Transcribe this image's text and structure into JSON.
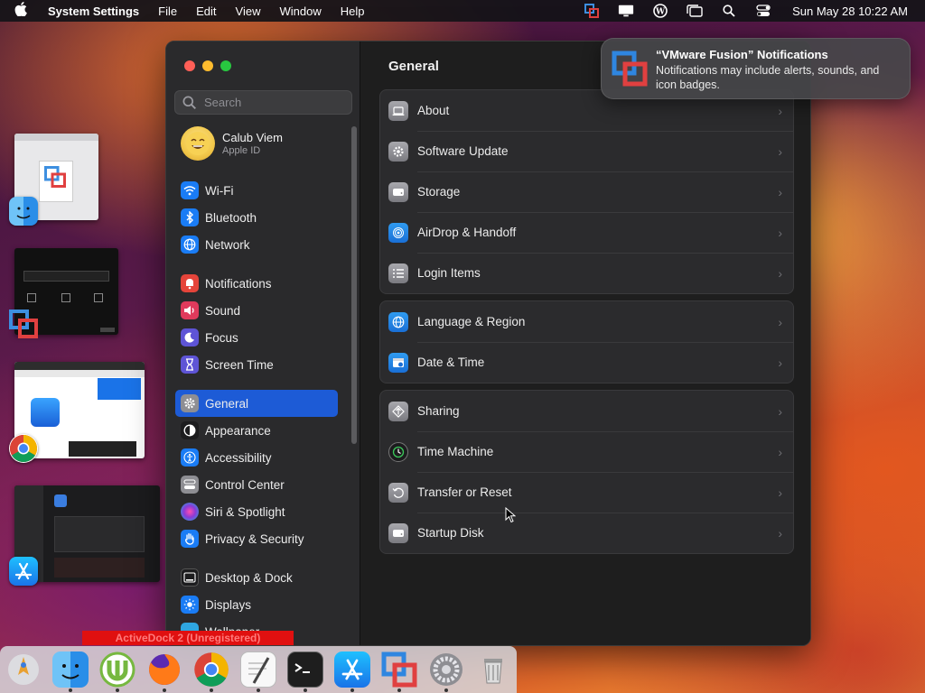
{
  "menubar": {
    "apple_icon": "apple-logo-icon",
    "app_name": "System Settings",
    "menus": [
      "File",
      "Edit",
      "View",
      "Window",
      "Help"
    ],
    "clock": "Sun May 28  10:22 AM",
    "status_icons": [
      "vmware-fusion-icon",
      "display-icon",
      "wordpress-icon",
      "stage-manager-icon",
      "search-icon",
      "control-center-icon"
    ]
  },
  "window": {
    "search_placeholder": "Search",
    "profile": {
      "name": "Calub Viem",
      "subtitle": "Apple ID"
    },
    "sidebar": {
      "items": [
        {
          "label": "Wi-Fi",
          "icon": "wifi-icon",
          "color": "#1a7cf5"
        },
        {
          "label": "Bluetooth",
          "icon": "bluetooth-icon",
          "color": "#1a7cf5"
        },
        {
          "label": "Network",
          "icon": "globe-icon",
          "color": "#1a7cf5"
        },
        {
          "label": "Notifications",
          "icon": "bell-icon",
          "color": "#e5443a"
        },
        {
          "label": "Sound",
          "icon": "speaker-icon",
          "color": "#e03a5c"
        },
        {
          "label": "Focus",
          "icon": "moon-icon",
          "color": "#5e54d6"
        },
        {
          "label": "Screen Time",
          "icon": "hourglass-icon",
          "color": "#5e54d6"
        },
        {
          "label": "General",
          "icon": "gear-icon",
          "color": "#8e8e93",
          "active": true
        },
        {
          "label": "Appearance",
          "icon": "appearance-icon",
          "color": "#1c1c1e"
        },
        {
          "label": "Accessibility",
          "icon": "accessibility-icon",
          "color": "#1a7cf5"
        },
        {
          "label": "Control Center",
          "icon": "control-center-icon",
          "color": "#8e8e93"
        },
        {
          "label": "Siri & Spotlight",
          "icon": "siri-icon",
          "color": "#b03ab5"
        },
        {
          "label": "Privacy & Security",
          "icon": "hand-icon",
          "color": "#1a7cf5"
        },
        {
          "label": "Desktop & Dock",
          "icon": "dock-icon",
          "color": "#1c1c1e"
        },
        {
          "label": "Displays",
          "icon": "sun-icon",
          "color": "#1a7cf5"
        },
        {
          "label": "Wallpaper",
          "icon": "wallpaper-icon",
          "color": "#2fa6e0"
        }
      ]
    },
    "content": {
      "title": "General",
      "groups": [
        {
          "rows": [
            {
              "label": "About",
              "icon": "laptop-icon"
            },
            {
              "label": "Software Update",
              "icon": "gear-badge-icon"
            },
            {
              "label": "Storage",
              "icon": "drive-icon"
            },
            {
              "label": "AirDrop & Handoff",
              "icon": "airdrop-icon"
            },
            {
              "label": "Login Items",
              "icon": "list-icon"
            }
          ]
        },
        {
          "rows": [
            {
              "label": "Language & Region",
              "icon": "globe-icon"
            },
            {
              "label": "Date & Time",
              "icon": "calendar-clock-icon"
            }
          ]
        },
        {
          "rows": [
            {
              "label": "Sharing",
              "icon": "sharing-icon"
            },
            {
              "label": "Time Machine",
              "icon": "time-machine-icon"
            },
            {
              "label": "Transfer or Reset",
              "icon": "reset-icon"
            },
            {
              "label": "Startup Disk",
              "icon": "startup-disk-icon"
            }
          ]
        }
      ]
    }
  },
  "notification": {
    "title": "“VMware Fusion” Notifications",
    "body": "Notifications may include alerts, sounds, and icon badges.",
    "icon": "vmware-fusion-icon"
  },
  "dock": {
    "banner": "ActiveDock 2 (Unregistered)",
    "items": [
      {
        "icon": "launchpad-icon",
        "running": false
      },
      {
        "icon": "finder-icon",
        "running": true
      },
      {
        "icon": "utorrent-icon",
        "running": true
      },
      {
        "icon": "firefox-icon",
        "running": true
      },
      {
        "icon": "chrome-icon",
        "running": true
      },
      {
        "icon": "textedit-icon",
        "running": true
      },
      {
        "icon": "terminal-icon",
        "running": true
      },
      {
        "icon": "app-store-icon",
        "running": true
      },
      {
        "icon": "vmware-fusion-icon",
        "running": true
      },
      {
        "icon": "system-settings-icon",
        "running": true
      },
      {
        "icon": "trash-icon",
        "running": false
      }
    ]
  },
  "stage_manager": [
    "finder-window-icon",
    "vmware-fusion-window-icon",
    "chrome-window-icon",
    "app-store-window-icon"
  ]
}
